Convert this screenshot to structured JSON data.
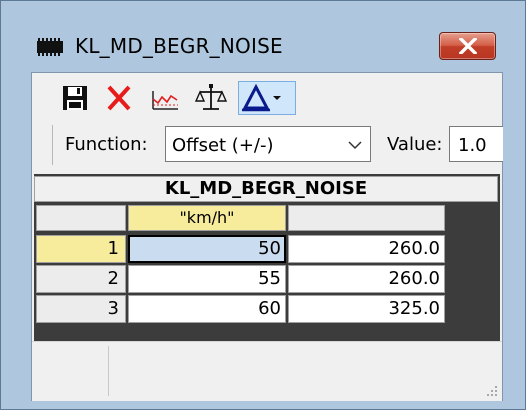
{
  "window": {
    "title": "KL_MD_BEGR_NOISE",
    "app_icon": "memory-chip-icon",
    "close_icon": "close-icon",
    "colors": {
      "titlebar": "#aec7de",
      "close": "#c9452e"
    }
  },
  "toolbar": {
    "buttons": [
      {
        "icon": "save-icon",
        "active": false
      },
      {
        "icon": "delete-icon",
        "active": false
      },
      {
        "icon": "line-chart-icon",
        "active": false
      },
      {
        "icon": "balance-scale-icon",
        "active": false
      },
      {
        "icon": "delta-dropdown-icon",
        "active": true
      }
    ]
  },
  "function_bar": {
    "function_label": "Function:",
    "function_value": "Offset (+/-)",
    "value_label": "Value:",
    "value_value": "1.0"
  },
  "table": {
    "title": "KL_MD_BEGR_NOISE",
    "x_header": "\"km/h\"",
    "rows": [
      {
        "index": "1",
        "x": "50",
        "y": "260.0",
        "selected": true
      },
      {
        "index": "2",
        "x": "55",
        "y": "260.0",
        "selected": false
      },
      {
        "index": "3",
        "x": "60",
        "y": "325.0",
        "selected": false
      }
    ]
  }
}
